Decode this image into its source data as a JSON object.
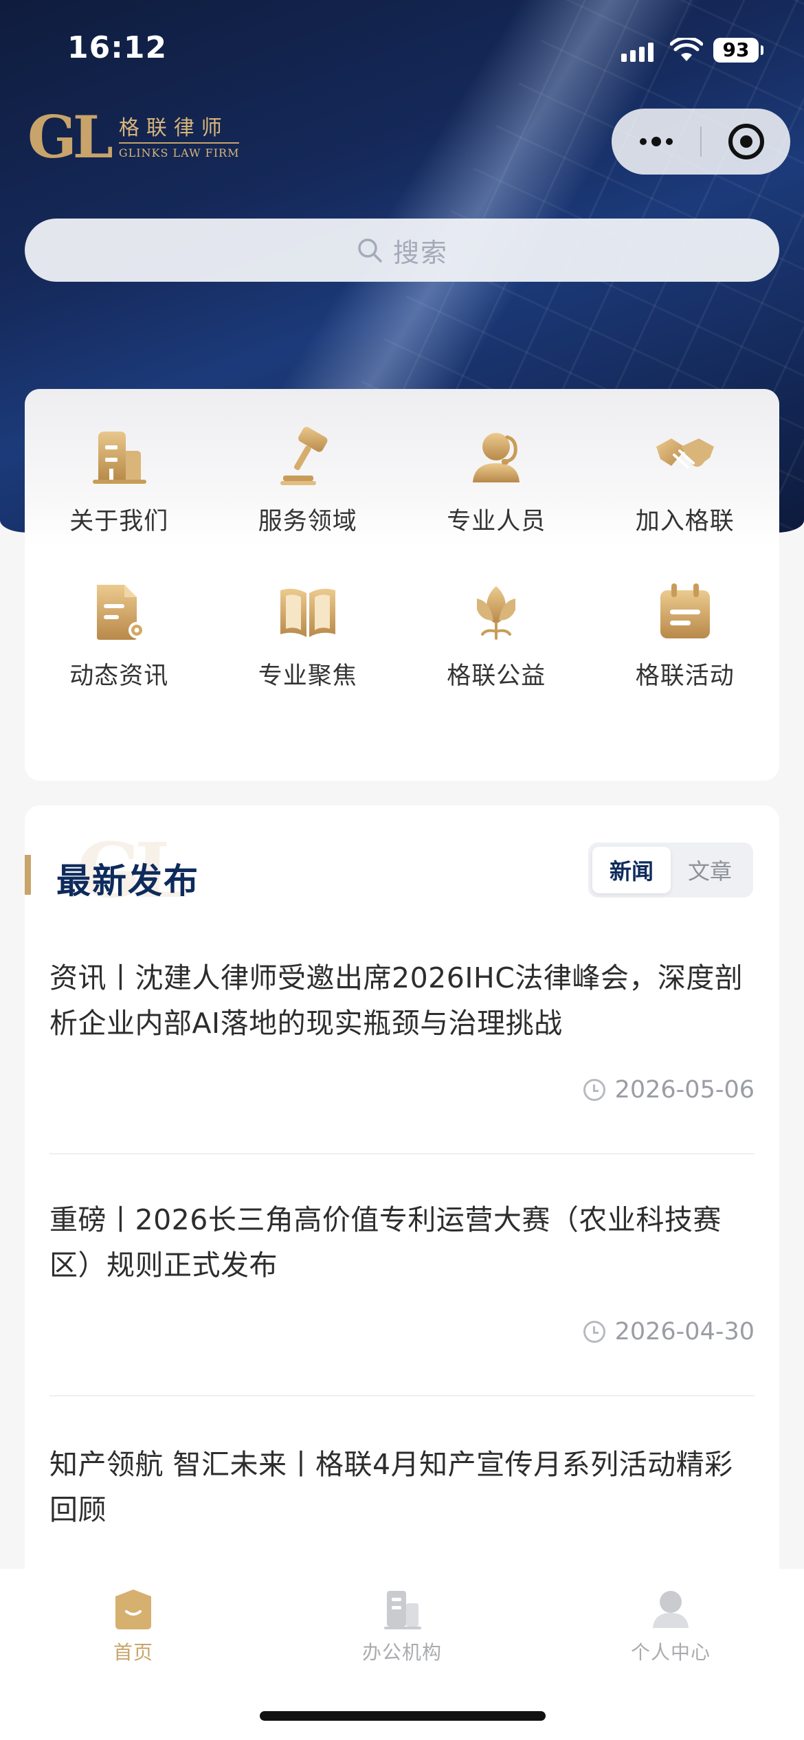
{
  "status_bar": {
    "time": "16:12",
    "battery": "93"
  },
  "brand": {
    "logo_mark": "GL",
    "name_cn": "格联律师",
    "name_en": "GLINKS LAW FIRM",
    "colors": {
      "gold": "#c8a46a",
      "navy": "#0e2b5c",
      "hero_blue": "#15295a"
    }
  },
  "capsule": {
    "more_icon": "more-dots-icon",
    "close_icon": "target-ring-icon"
  },
  "search": {
    "placeholder": "搜索",
    "icon": "search-icon"
  },
  "menu": {
    "items": [
      {
        "label": "关于我们",
        "icon": "building-icon"
      },
      {
        "label": "服务领域",
        "icon": "gavel-icon"
      },
      {
        "label": "专业人员",
        "icon": "person-icon"
      },
      {
        "label": "加入格联",
        "icon": "handshake-icon"
      },
      {
        "label": "动态资讯",
        "icon": "document-certificate-icon"
      },
      {
        "label": "专业聚焦",
        "icon": "open-book-icon"
      },
      {
        "label": "格联公益",
        "icon": "lotus-icon"
      },
      {
        "label": "格联活动",
        "icon": "calendar-icon"
      }
    ]
  },
  "news": {
    "section_title": "最新发布",
    "watermark": "GL",
    "tabs": [
      {
        "label": "新闻",
        "active": true
      },
      {
        "label": "文章",
        "active": false
      }
    ],
    "items": [
      {
        "title": "资讯丨沈建人律师受邀出席2026IHC法律峰会，深度剖析企业内部AI落地的现实瓶颈与治理挑战",
        "date": "2026-05-06"
      },
      {
        "title": "重磅丨2026长三角高价值专利运营大赛（农业科技赛区）规则正式发布",
        "date": "2026-04-30"
      },
      {
        "title": "知产领航 智汇未来丨格联4月知产宣传月系列活动精彩回顾",
        "date": ""
      }
    ]
  },
  "tabbar": {
    "items": [
      {
        "label": "首页",
        "icon": "home-icon",
        "active": true
      },
      {
        "label": "办公机构",
        "icon": "office-building-icon",
        "active": false
      },
      {
        "label": "个人中心",
        "icon": "user-icon",
        "active": false
      }
    ]
  }
}
